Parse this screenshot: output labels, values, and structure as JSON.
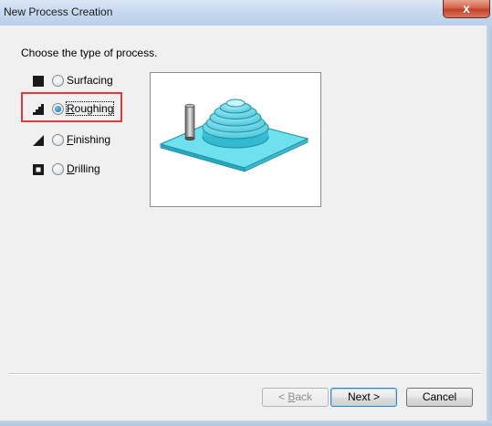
{
  "window": {
    "title": "New Process Creation",
    "close_glyph": "x"
  },
  "prompt": "Choose the type of process.",
  "options": [
    {
      "label": "Surfacing",
      "mnemonic": "",
      "rest": "Surfacing",
      "icon": "surfacing-icon",
      "selected": false
    },
    {
      "label": "Roughing",
      "mnemonic": "R",
      "rest": "oughing",
      "icon": "roughing-icon",
      "selected": true
    },
    {
      "label": "Finishing",
      "mnemonic": "F",
      "rest": "inishing",
      "icon": "finishing-icon",
      "selected": false
    },
    {
      "label": "Drilling",
      "mnemonic": "D",
      "rest": "rilling",
      "icon": "drilling-icon",
      "selected": false
    }
  ],
  "buttons": {
    "back": {
      "mnemonic": "B",
      "before": "< ",
      "after": "ack",
      "enabled": false
    },
    "next": {
      "label": "Next >",
      "default": true
    },
    "cancel": {
      "label": "Cancel"
    }
  },
  "colors": {
    "highlight": "#e03a3a",
    "part_fill": "#5fd3e6",
    "part_stroke": "#1d8fa3"
  }
}
